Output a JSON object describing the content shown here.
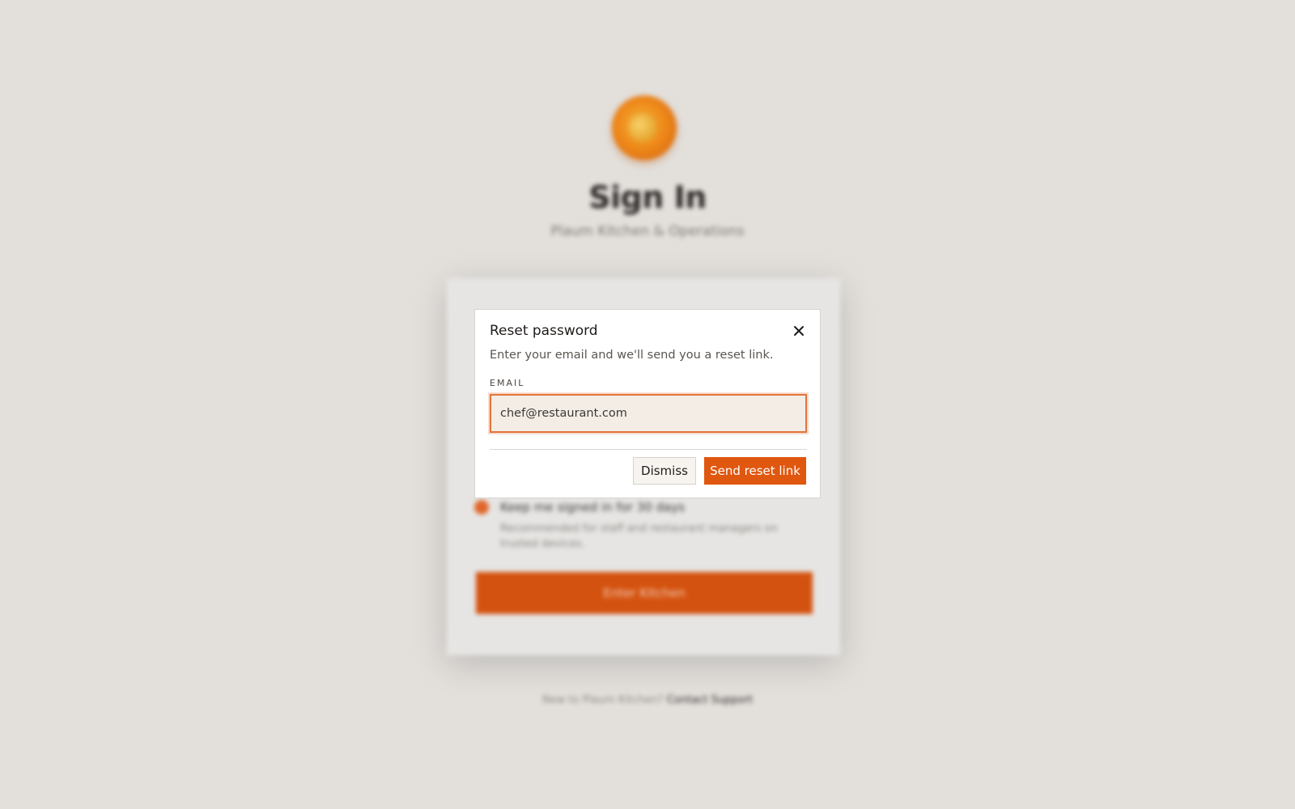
{
  "background": {
    "title": "Sign In",
    "subtitle": "Plaum Kitchen & Operations",
    "keep_signed_in": "Keep me signed in for 30 days",
    "keep_signed_in_note": "Recommended for staff and restaurant managers on trusted devices.",
    "enter_button": "Enter Kitchen",
    "footer_text": "New to Plaum Kitchen?",
    "footer_link": "Contact Support"
  },
  "modal": {
    "title": "Reset password",
    "description": "Enter your email and we'll send you a reset link.",
    "email_label": "EMAIL",
    "email_value": "chef@restaurant.com",
    "dismiss_label": "Dismiss",
    "send_label": "Send reset link",
    "close_icon": "close-icon"
  },
  "colors": {
    "accent": "#e0570f",
    "background": "#e3e0dc",
    "input_focus": "#e2733b"
  }
}
